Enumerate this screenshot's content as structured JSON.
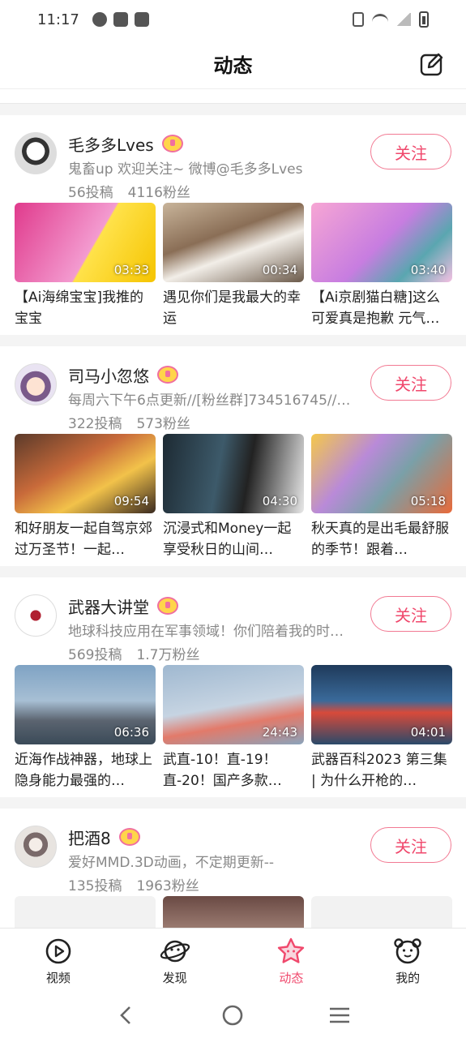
{
  "status_bar": {
    "time": "11:17"
  },
  "header": {
    "title": "动态"
  },
  "follow_label": "关注",
  "feed": [
    {
      "name": "毛多多Lves",
      "desc": "鬼畜up 欢迎关注~ 微博@毛多多Lves",
      "posts": "56投稿",
      "fans": "4116粉丝",
      "videos": [
        {
          "duration": "03:33",
          "title": "【Ai海绵宝宝]我推的宝宝"
        },
        {
          "duration": "00:34",
          "title": "遇见你们是我最大的幸运"
        },
        {
          "duration": "03:40",
          "title": "【Ai京剧猫白糖]这么可爱真是抱歉 元气…"
        }
      ]
    },
    {
      "name": "司马小忽悠",
      "desc": "每周六下午6点更新//[粉丝群]734516745//…",
      "posts": "322投稿",
      "fans": "573粉丝",
      "videos": [
        {
          "duration": "09:54",
          "title": "和好朋友一起自驾京郊过万圣节！一起…"
        },
        {
          "duration": "04:30",
          "title": "沉浸式和Money一起享受秋日的山间…"
        },
        {
          "duration": "05:18",
          "title": "秋天真的是出毛最舒服的季节！跟着…"
        }
      ]
    },
    {
      "name": "武器大讲堂",
      "desc": "地球科技应用在军事领域！你们陪着我的时…",
      "posts": "569投稿",
      "fans": "1.7万粉丝",
      "videos": [
        {
          "duration": "06:36",
          "title": "近海作战神器，地球上隐身能力最强的…"
        },
        {
          "duration": "24:43",
          "title": "武直-10！直-19！直-20！国产多款…"
        },
        {
          "duration": "04:01",
          "title": "武器百科2023 第三集 | 为什么开枪的…"
        }
      ]
    },
    {
      "name": "把酒8",
      "desc": "爱好MMD.3D动画，不定期更新--",
      "posts": "135投稿",
      "fans": "1963粉丝",
      "videos": [
        {
          "duration": "",
          "title": ""
        },
        {
          "duration": "",
          "title": ""
        },
        {
          "duration": "",
          "title": ""
        }
      ]
    }
  ],
  "nav": {
    "video": "视频",
    "discover": "发现",
    "dynamic": "动态",
    "mine": "我的"
  },
  "colors": {
    "accent": "#f0486c"
  }
}
